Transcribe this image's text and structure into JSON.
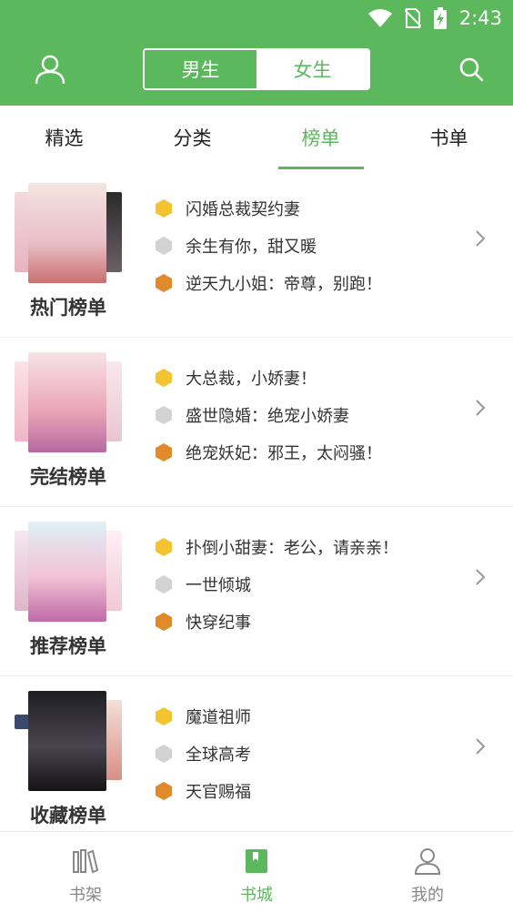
{
  "status_bar": {
    "time": "2:43"
  },
  "header": {
    "gender_tabs": [
      {
        "label": "男生"
      },
      {
        "label": "女生"
      }
    ],
    "brand_color": "#5cb85c",
    "user_icon": "user-icon",
    "search_icon": "search-icon"
  },
  "tabs": [
    {
      "label": "精选"
    },
    {
      "label": "分类"
    },
    {
      "label": "榜单"
    },
    {
      "label": "书单"
    }
  ],
  "active_tab": "榜单",
  "sections": [
    {
      "title": "热门榜单",
      "items": [
        "闪婚总裁契约妻",
        "余生有你，甜又暖",
        "逆天九小姐：帝尊，别跑！"
      ]
    },
    {
      "title": "完结榜单",
      "items": [
        "大总裁，小娇妻！",
        "盛世隐婚：绝宠小娇妻",
        "绝宠妖妃：邪王，太闷骚！"
      ]
    },
    {
      "title": "推荐榜单",
      "items": [
        "扑倒小甜妻：老公，请亲亲！",
        "一世倾城",
        "快穿纪事"
      ]
    },
    {
      "title": "收藏榜单",
      "items": [
        "魔道祖师",
        "全球高考",
        "天官赐福"
      ]
    }
  ],
  "medal_colors": {
    "gold": "#f4c430",
    "silver": "#d3d3d3",
    "bronze": "#e08a2c"
  },
  "bottom_nav": [
    {
      "label": "书架"
    },
    {
      "label": "书城"
    },
    {
      "label": "我的"
    }
  ],
  "active_nav": "书城"
}
